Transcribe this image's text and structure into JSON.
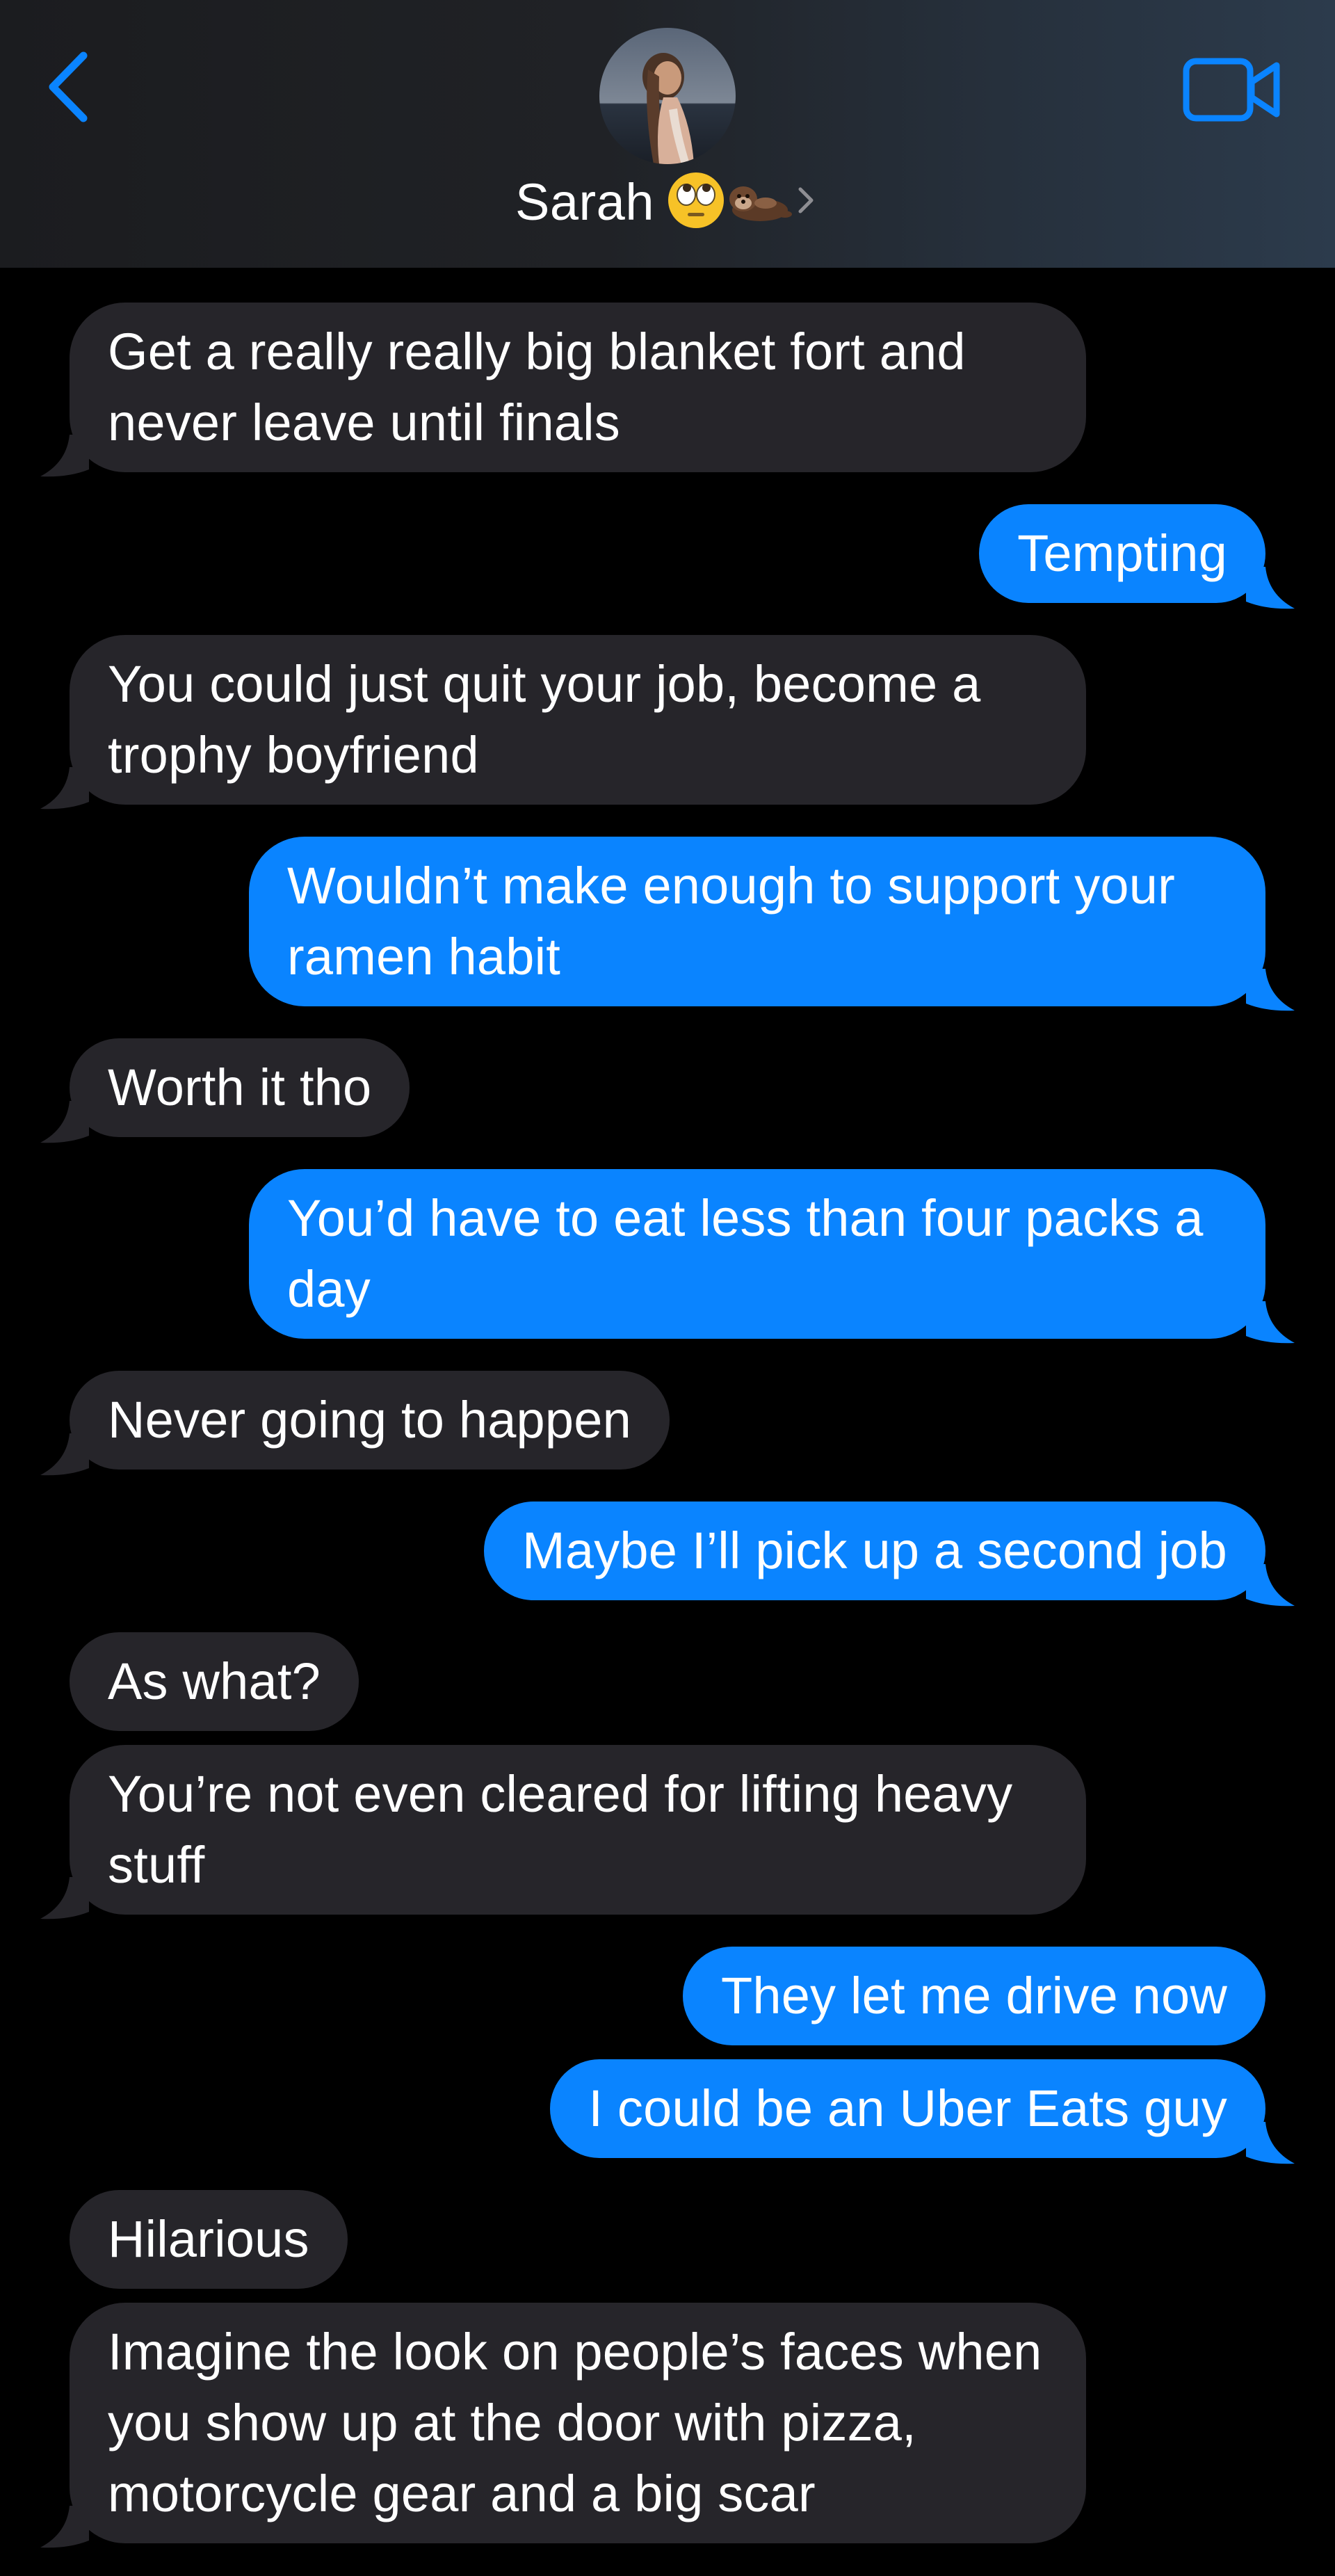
{
  "header": {
    "contact_name": "Sarah",
    "contact_emojis": [
      "face-with-rolling-eyes",
      "otter"
    ],
    "icons": {
      "back": "chevron-left-icon",
      "video": "video-camera-icon",
      "disclosure": "chevron-right-icon"
    },
    "accent_color": "#0a84ff"
  },
  "messages": [
    {
      "from": "them",
      "text": "Get a really really big blanket fort and never leave until finals"
    },
    {
      "from": "me",
      "text": "Tempting"
    },
    {
      "from": "them",
      "text": "You could just quit your job, become a trophy boyfriend"
    },
    {
      "from": "me",
      "text": "Wouldn’t make enough to support your ramen habit"
    },
    {
      "from": "them",
      "text": "Worth it tho"
    },
    {
      "from": "me",
      "text": "You’d have to eat less than four packs a day"
    },
    {
      "from": "them",
      "text": "Never going to happen"
    },
    {
      "from": "me",
      "text": "Maybe I’ll pick up a second job"
    },
    {
      "from": "them",
      "text": "As what?"
    },
    {
      "from": "them",
      "text": "You’re not even cleared for lifting heavy stuff"
    },
    {
      "from": "me",
      "text": "They let me drive now"
    },
    {
      "from": "me",
      "text": "I could be an Uber Eats guy"
    },
    {
      "from": "them",
      "text": "Hilarious"
    },
    {
      "from": "them",
      "text": "Imagine the look on people’s faces when you show up at the door with pizza, motorcycle gear and a big scar"
    }
  ],
  "colors": {
    "incoming_bubble": "#26252a",
    "outgoing_bubble": "#0a84ff",
    "background": "#000000"
  }
}
